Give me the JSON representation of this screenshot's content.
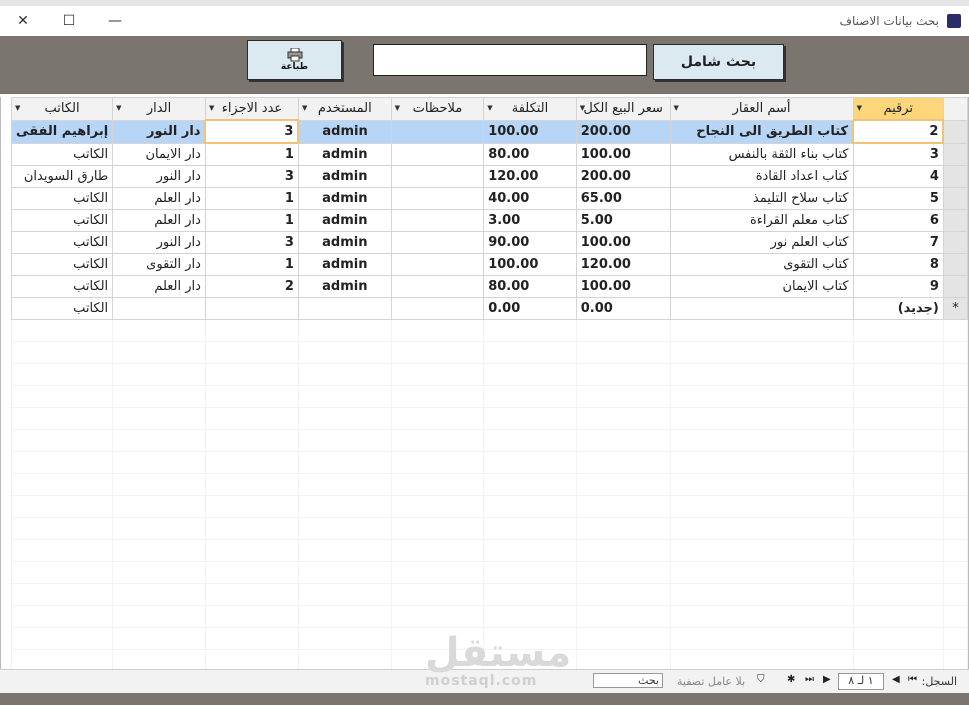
{
  "window": {
    "title": "بحث بيانات الاصناف"
  },
  "toolbar": {
    "print_label": "طباعة",
    "search_label": "بحث شامل",
    "search_value": ""
  },
  "columns": [
    "ترقيم",
    "أسم العقار",
    "سعر البيع الكل",
    "التكلفة",
    "ملاحظات",
    "المستخدم",
    "عدد الاجزاء",
    "الدار",
    "الكاتب"
  ],
  "rows": [
    {
      "id": "2",
      "name": "كتاب الطريق الى النجاح",
      "price": "200.00",
      "cost": "100.00",
      "notes": "",
      "user": "admin",
      "parts": "3",
      "house": "دار النور",
      "author": "إبراهيم الفقى"
    },
    {
      "id": "3",
      "name": "كتاب بناء الثقة بالنفس",
      "price": "100.00",
      "cost": "80.00",
      "notes": "",
      "user": "admin",
      "parts": "1",
      "house": "دار الايمان",
      "author": "الكاتب"
    },
    {
      "id": "4",
      "name": "كتاب اعداد القادة",
      "price": "200.00",
      "cost": "120.00",
      "notes": "",
      "user": "admin",
      "parts": "3",
      "house": "دار النور",
      "author": "طارق السويدان"
    },
    {
      "id": "5",
      "name": "كتاب سلاح التليمذ",
      "price": "65.00",
      "cost": "40.00",
      "notes": "",
      "user": "admin",
      "parts": "1",
      "house": "دار العلم",
      "author": "الكاتب"
    },
    {
      "id": "6",
      "name": "كتاب معلم القراءة",
      "price": "5.00",
      "cost": "3.00",
      "notes": "",
      "user": "admin",
      "parts": "1",
      "house": "دار العلم",
      "author": "الكاتب"
    },
    {
      "id": "7",
      "name": "كتاب العلم نور",
      "price": "100.00",
      "cost": "90.00",
      "notes": "",
      "user": "admin",
      "parts": "3",
      "house": "دار النور",
      "author": "الكاتب"
    },
    {
      "id": "8",
      "name": "كتاب التقوى",
      "price": "120.00",
      "cost": "100.00",
      "notes": "",
      "user": "admin",
      "parts": "1",
      "house": "دار التقوى",
      "author": "الكاتب"
    },
    {
      "id": "9",
      "name": "كتاب الايمان",
      "price": "100.00",
      "cost": "80.00",
      "notes": "",
      "user": "admin",
      "parts": "2",
      "house": "دار العلم",
      "author": "الكاتب"
    }
  ],
  "new_row": {
    "id": "(جديد)",
    "price": "0.00",
    "cost": "0.00",
    "author": "الكاتب",
    "marker": "*"
  },
  "status": {
    "record_label": "السجل:",
    "record_value": "١ لـ ٨",
    "no_filter": "بلا عامل تصفية",
    "search_placeholder": "بحث"
  },
  "watermark": {
    "text": "مستقل",
    "url": "mostaql.com"
  }
}
